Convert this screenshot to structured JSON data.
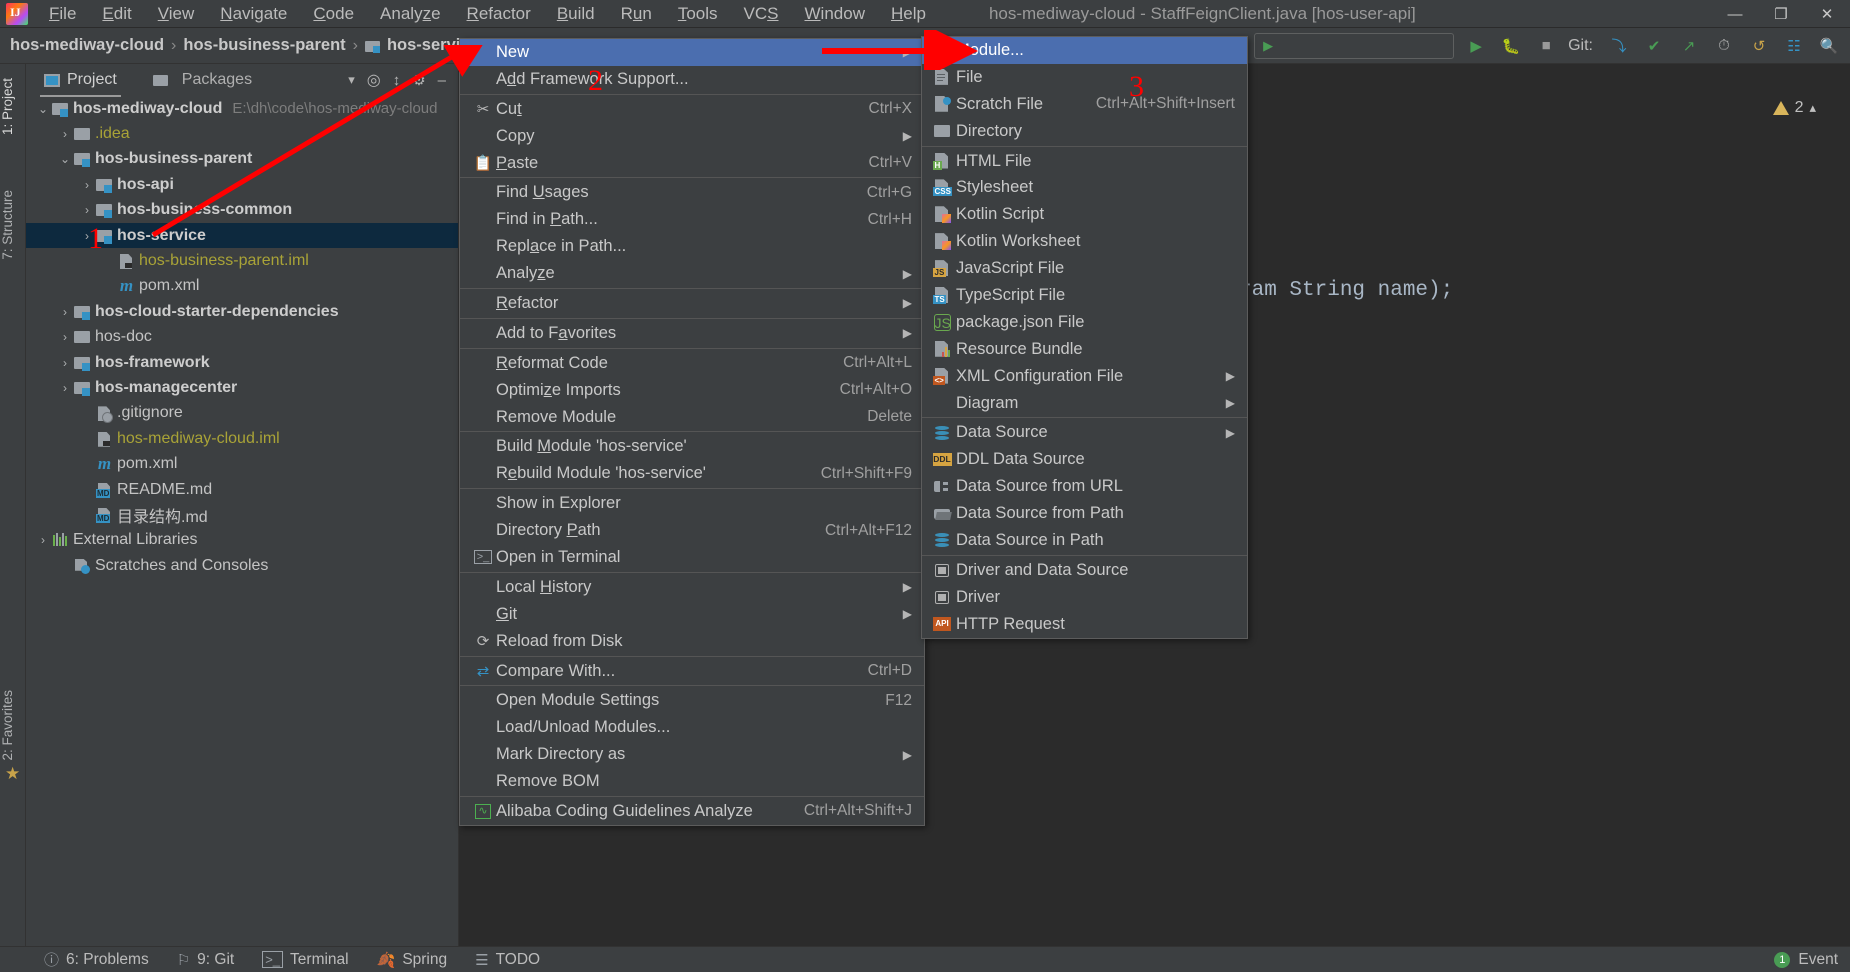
{
  "window": {
    "title": "hos-mediway-cloud - StaffFeignClient.java [hos-user-api]",
    "minimize": "—",
    "maximize": "❐",
    "close": "✕"
  },
  "menubar": [
    {
      "label": "File",
      "mnemonic": "F"
    },
    {
      "label": "Edit",
      "mnemonic": "E"
    },
    {
      "label": "View",
      "mnemonic": "V"
    },
    {
      "label": "Navigate",
      "mnemonic": "N"
    },
    {
      "label": "Code",
      "mnemonic": "C"
    },
    {
      "label": "Analyze",
      "mnemonic": "z"
    },
    {
      "label": "Refactor",
      "mnemonic": "R"
    },
    {
      "label": "Build",
      "mnemonic": "B"
    },
    {
      "label": "Run",
      "mnemonic": "u"
    },
    {
      "label": "Tools",
      "mnemonic": "T"
    },
    {
      "label": "VCS",
      "mnemonic": "S"
    },
    {
      "label": "Window",
      "mnemonic": "W"
    },
    {
      "label": "Help",
      "mnemonic": "H"
    }
  ],
  "breadcrumb": {
    "items": [
      {
        "label": "hos-mediway-cloud",
        "icon": "none"
      },
      {
        "label": "hos-business-parent",
        "icon": "none"
      },
      {
        "label": "hos-service",
        "icon": "module-icon"
      }
    ],
    "separator": "›"
  },
  "navbar_right": {
    "git_label": "Git:",
    "run_config_placeholder": ""
  },
  "left_stripe": [
    {
      "label": "1: Project",
      "active": true
    },
    {
      "label": "7: Structure",
      "active": false
    },
    {
      "label": "2: Favorites",
      "active": false
    }
  ],
  "project_panel": {
    "tabs": [
      {
        "label": "Project",
        "icon": "project-icon",
        "active": true
      },
      {
        "label": "Packages",
        "icon": "folder-icon",
        "active": false
      }
    ],
    "header_icons": [
      "chevron-down-icon",
      "locate-icon",
      "collapse-all-icon",
      "settings-icon",
      "hide-icon"
    ],
    "tree": [
      {
        "indent": 0,
        "twist": "⌄",
        "icon": "module",
        "label": "hos-mediway-cloud",
        "style": "bold",
        "path": "E:\\dh\\code\\hos-mediway-cloud"
      },
      {
        "indent": 1,
        "twist": "›",
        "icon": "folder",
        "label": ".idea",
        "style": "yellow",
        "path": ""
      },
      {
        "indent": 1,
        "twist": "⌄",
        "icon": "module",
        "label": "hos-business-parent",
        "style": "bold",
        "path": ""
      },
      {
        "indent": 2,
        "twist": "›",
        "icon": "module",
        "label": "hos-api",
        "style": "bold",
        "path": ""
      },
      {
        "indent": 2,
        "twist": "›",
        "icon": "module",
        "label": "hos-business-common",
        "style": "bold",
        "path": ""
      },
      {
        "indent": 2,
        "twist": "›",
        "icon": "module",
        "label": "hos-service",
        "style": "bold",
        "path": "",
        "selected": true
      },
      {
        "indent": 3,
        "twist": "",
        "icon": "iml",
        "label": "hos-business-parent.iml",
        "style": "yellow",
        "path": ""
      },
      {
        "indent": 3,
        "twist": "",
        "icon": "maven",
        "label": "pom.xml",
        "style": "plain",
        "path": ""
      },
      {
        "indent": 1,
        "twist": "›",
        "icon": "module",
        "label": "hos-cloud-starter-dependencies",
        "style": "bold",
        "path": ""
      },
      {
        "indent": 1,
        "twist": "›",
        "icon": "folder",
        "label": "hos-doc",
        "style": "plain",
        "path": ""
      },
      {
        "indent": 1,
        "twist": "›",
        "icon": "module",
        "label": "hos-framework",
        "style": "bold",
        "path": ""
      },
      {
        "indent": 1,
        "twist": "›",
        "icon": "module",
        "label": "hos-managecenter",
        "style": "bold",
        "path": ""
      },
      {
        "indent": 2,
        "twist": "",
        "icon": "gitig",
        "label": ".gitignore",
        "style": "plain",
        "path": ""
      },
      {
        "indent": 2,
        "twist": "",
        "icon": "iml",
        "label": "hos-mediway-cloud.iml",
        "style": "yellow",
        "path": ""
      },
      {
        "indent": 2,
        "twist": "",
        "icon": "maven",
        "label": "pom.xml",
        "style": "plain",
        "path": ""
      },
      {
        "indent": 2,
        "twist": "",
        "icon": "md",
        "label": "README.md",
        "style": "plain",
        "path": ""
      },
      {
        "indent": 2,
        "twist": "",
        "icon": "md",
        "label": "目录结构.md",
        "style": "plain",
        "path": ""
      },
      {
        "indent": 0,
        "twist": "›",
        "icon": "libs",
        "label": "External Libraries",
        "style": "plain",
        "path": ""
      },
      {
        "indent": 1,
        "twist": "",
        "icon": "scratch",
        "label": "Scratches and Consoles",
        "style": "plain",
        "path": ""
      }
    ]
  },
  "editor": {
    "code_fragment": "ram String name);",
    "inspection_count": "2"
  },
  "context_menu": {
    "items": [
      {
        "label": "New",
        "shortcut": "",
        "icon": "",
        "arrow": true,
        "highlight": true,
        "mnemonic": ""
      },
      {
        "label": "Add Framework Support...",
        "shortcut": "",
        "icon": "",
        "arrow": false,
        "mnemonic": "d"
      },
      {
        "sep": true
      },
      {
        "label": "Cut",
        "shortcut": "Ctrl+X",
        "icon": "scissors-icon",
        "arrow": false,
        "mnemonic": "t"
      },
      {
        "label": "Copy",
        "shortcut": "",
        "icon": "",
        "arrow": true,
        "mnemonic": ""
      },
      {
        "label": "Paste",
        "shortcut": "Ctrl+V",
        "icon": "clipboard-icon",
        "arrow": false,
        "mnemonic": "P"
      },
      {
        "sep": true
      },
      {
        "label": "Find Usages",
        "shortcut": "Ctrl+G",
        "icon": "",
        "arrow": false,
        "mnemonic": "U"
      },
      {
        "label": "Find in Path...",
        "shortcut": "Ctrl+H",
        "icon": "",
        "arrow": false,
        "mnemonic": "P"
      },
      {
        "label": "Replace in Path...",
        "shortcut": "",
        "icon": "",
        "arrow": false,
        "mnemonic": "a"
      },
      {
        "label": "Analyze",
        "shortcut": "",
        "icon": "",
        "arrow": true,
        "mnemonic": "z"
      },
      {
        "sep": true
      },
      {
        "label": "Refactor",
        "shortcut": "",
        "icon": "",
        "arrow": true,
        "mnemonic": "R"
      },
      {
        "sep": true
      },
      {
        "label": "Add to Favorites",
        "shortcut": "",
        "icon": "",
        "arrow": true,
        "mnemonic": "a"
      },
      {
        "sep": true
      },
      {
        "label": "Reformat Code",
        "shortcut": "Ctrl+Alt+L",
        "icon": "",
        "arrow": false,
        "mnemonic": "R"
      },
      {
        "label": "Optimize Imports",
        "shortcut": "Ctrl+Alt+O",
        "icon": "",
        "arrow": false,
        "mnemonic": "z"
      },
      {
        "label": "Remove Module",
        "shortcut": "Delete",
        "icon": "",
        "arrow": false,
        "mnemonic": ""
      },
      {
        "sep": true
      },
      {
        "label": "Build Module 'hos-service'",
        "shortcut": "",
        "icon": "",
        "arrow": false,
        "mnemonic": "M"
      },
      {
        "label": "Rebuild Module 'hos-service'",
        "shortcut": "Ctrl+Shift+F9",
        "icon": "",
        "arrow": false,
        "mnemonic": "e"
      },
      {
        "sep": true
      },
      {
        "label": "Show in Explorer",
        "shortcut": "",
        "icon": "",
        "arrow": false,
        "mnemonic": ""
      },
      {
        "label": "Directory Path",
        "shortcut": "Ctrl+Alt+F12",
        "icon": "",
        "arrow": false,
        "mnemonic": "P"
      },
      {
        "label": "Open in Terminal",
        "shortcut": "",
        "icon": "terminal-icon",
        "arrow": false,
        "mnemonic": ""
      },
      {
        "sep": true
      },
      {
        "label": "Local History",
        "shortcut": "",
        "icon": "",
        "arrow": true,
        "mnemonic": "H"
      },
      {
        "label": "Git",
        "shortcut": "",
        "icon": "",
        "arrow": true,
        "mnemonic": "G"
      },
      {
        "label": "Reload from Disk",
        "shortcut": "",
        "icon": "refresh-icon",
        "arrow": false,
        "mnemonic": ""
      },
      {
        "sep": true
      },
      {
        "label": "Compare With...",
        "shortcut": "Ctrl+D",
        "icon": "compare-icon",
        "arrow": false,
        "mnemonic": ""
      },
      {
        "sep": true
      },
      {
        "label": "Open Module Settings",
        "shortcut": "F12",
        "icon": "",
        "arrow": false,
        "mnemonic": ""
      },
      {
        "label": "Load/Unload Modules...",
        "shortcut": "",
        "icon": "",
        "arrow": false,
        "mnemonic": ""
      },
      {
        "label": "Mark Directory as",
        "shortcut": "",
        "icon": "",
        "arrow": true,
        "mnemonic": ""
      },
      {
        "label": "Remove BOM",
        "shortcut": "",
        "icon": "",
        "arrow": false,
        "mnemonic": ""
      },
      {
        "sep": true
      },
      {
        "label": "Alibaba Coding Guidelines Analyze",
        "shortcut": "Ctrl+Alt+Shift+J",
        "icon": "alibaba-icon",
        "arrow": false,
        "mnemonic": ""
      }
    ]
  },
  "submenu": {
    "items": [
      {
        "label": "Module...",
        "shortcut": "",
        "icon": "module-icon",
        "arrow": false,
        "highlight": true
      },
      {
        "label": "File",
        "shortcut": "",
        "icon": "file-icon",
        "arrow": false
      },
      {
        "label": "Scratch File",
        "shortcut": "Ctrl+Alt+Shift+Insert",
        "icon": "scratch-file-icon",
        "arrow": false
      },
      {
        "label": "Directory",
        "shortcut": "",
        "icon": "directory-icon",
        "arrow": false
      },
      {
        "sep": true
      },
      {
        "label": "HTML File",
        "shortcut": "",
        "icon": "html-file-icon",
        "arrow": false
      },
      {
        "label": "Stylesheet",
        "shortcut": "",
        "icon": "css-file-icon",
        "arrow": false
      },
      {
        "label": "Kotlin Script",
        "shortcut": "",
        "icon": "kotlin-icon",
        "arrow": false
      },
      {
        "label": "Kotlin Worksheet",
        "shortcut": "",
        "icon": "kotlin-icon",
        "arrow": false
      },
      {
        "label": "JavaScript File",
        "shortcut": "",
        "icon": "js-file-icon",
        "arrow": false
      },
      {
        "label": "TypeScript File",
        "shortcut": "",
        "icon": "ts-file-icon",
        "arrow": false
      },
      {
        "label": "package.json File",
        "shortcut": "",
        "icon": "nodejs-icon",
        "arrow": false
      },
      {
        "label": "Resource Bundle",
        "shortcut": "",
        "icon": "resource-bundle-icon",
        "arrow": false
      },
      {
        "label": "XML Configuration File",
        "shortcut": "",
        "icon": "xml-file-icon",
        "arrow": true
      },
      {
        "label": "Diagram",
        "shortcut": "",
        "icon": "",
        "arrow": true
      },
      {
        "sep": true
      },
      {
        "label": "Data Source",
        "shortcut": "",
        "icon": "database-icon",
        "arrow": true
      },
      {
        "label": "DDL Data Source",
        "shortcut": "",
        "icon": "ddl-icon",
        "arrow": false
      },
      {
        "label": "Data Source from URL",
        "shortcut": "",
        "icon": "url-datasource-icon",
        "arrow": false
      },
      {
        "label": "Data Source from Path",
        "shortcut": "",
        "icon": "folder-open-icon",
        "arrow": false
      },
      {
        "label": "Data Source in Path",
        "shortcut": "",
        "icon": "database-icon",
        "arrow": false
      },
      {
        "sep": true
      },
      {
        "label": "Driver and Data Source",
        "shortcut": "",
        "icon": "driver-datasource-icon",
        "arrow": false
      },
      {
        "label": "Driver",
        "shortcut": "",
        "icon": "driver-icon",
        "arrow": false
      },
      {
        "label": "HTTP Request",
        "shortcut": "",
        "icon": "http-request-icon",
        "arrow": false
      }
    ]
  },
  "statusbar": {
    "items": [
      {
        "label": "6: Problems",
        "icon": "problems-icon",
        "mnemonic": "6"
      },
      {
        "label": "9: Git",
        "icon": "git-icon",
        "mnemonic": "9"
      },
      {
        "label": "Terminal",
        "icon": "terminal-icon",
        "mnemonic": ""
      },
      {
        "label": "Spring",
        "icon": "spring-icon",
        "mnemonic": ""
      },
      {
        "label": "TODO",
        "icon": "todo-icon",
        "mnemonic": ""
      }
    ],
    "right": {
      "event_label": "Event",
      "event_count": "1"
    }
  },
  "annotations": {
    "marker_1": "1",
    "marker_2": "2",
    "marker_3": "3",
    "arrow_color": "#ff0000"
  }
}
